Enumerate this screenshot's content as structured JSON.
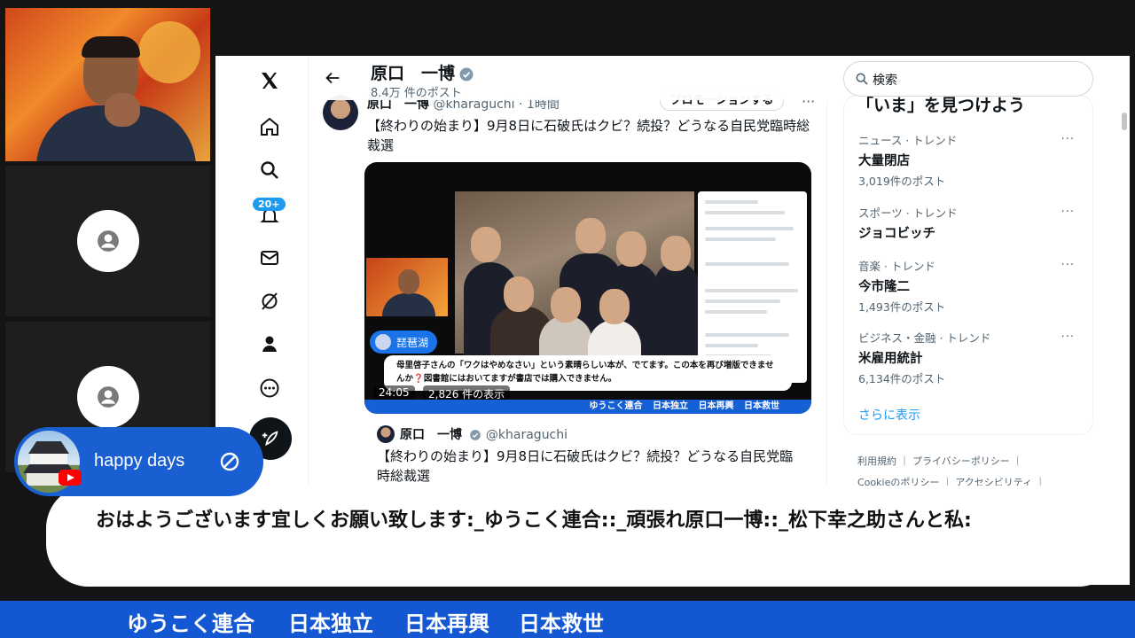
{
  "stream": {
    "overlay_user": "happy days",
    "comment": "おはようございます宜しくお願い致します:_ゆうこく連合::_頑張れ原口一博::_松下幸之助さんと私:",
    "ticker": [
      "ゆうこく連合",
      "日本独立",
      "日本再興",
      "日本救世"
    ]
  },
  "twitter": {
    "profile_name": "原口　一博",
    "post_count": "8.4万 件のポスト",
    "notification_badge": "20+",
    "tweet": {
      "author": "原口　一博",
      "handle_time": "@kharaguchi · 1時間",
      "promo_label": "プロモーションする",
      "more": "···",
      "text": "【終わりの始まり】9月8日に石破氏はクビ？続投？どうなる自民党臨時総裁選",
      "video": {
        "chip_label": "琵琶湖",
        "caption": "母里啓子さんの「ワクはやめなさい」という素晴らしい本が、でてます。この本を再び増版できませんか❓図書館にはおいてますが書店では購入できません。",
        "duration": "24:05",
        "views": "2,826 件の表示",
        "banner": "ゆうこく連合 日本独立 日本再興 日本救世"
      }
    },
    "quoted": {
      "author": "原口　一博",
      "handle": "@kharaguchi",
      "text": "【終わりの始まり】9月8日に石破氏はクビ？続投？どうなる自民党臨時総裁選"
    },
    "sidebar": {
      "search_placeholder": "検索",
      "trends_title": "「いま」を見つけよう",
      "trends": [
        {
          "category": "ニュース · トレンド",
          "name": "大量閉店",
          "count": "3,019件のポスト"
        },
        {
          "category": "スポーツ · トレンド",
          "name": "ジョコビッチ",
          "count": ""
        },
        {
          "category": "音楽 · トレンド",
          "name": "今市隆二",
          "count": "1,493件のポスト"
        },
        {
          "category": "ビジネス・金融 · トレンド",
          "name": "米雇用統計",
          "count": "6,134件のポスト"
        }
      ],
      "show_more": "さらに表示",
      "footer_row1": "利用規約 ｜ プライバシーポリシー ｜",
      "footer_row2": "Cookieのポリシー ｜ アクセシビリティ ｜"
    }
  },
  "colors": {
    "accent": "#1d9bf0",
    "ticker_bg": "#1457d2",
    "chip_bg": "#1a5fd1"
  }
}
